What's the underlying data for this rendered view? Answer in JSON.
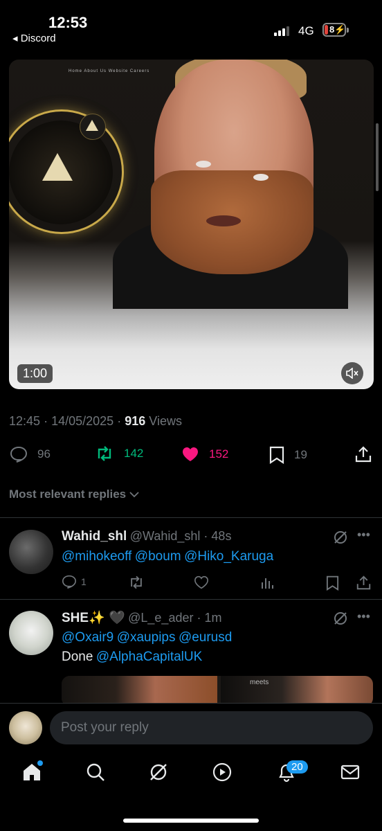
{
  "status_bar": {
    "time": "12:53",
    "back_app": "◂ Discord",
    "network": "4G",
    "battery": "8"
  },
  "video": {
    "site_nav": "Home   About Us   Website   Careers",
    "duration": "1:00",
    "mute_icon": "speaker-muted-icon"
  },
  "post_meta": {
    "time": "12:45",
    "date": "14/05/2025",
    "views_count": "916",
    "views_label": "Views",
    "sep": "·"
  },
  "stats": {
    "replies": "96",
    "reposts": "142",
    "likes": "152",
    "bookmarks": "19"
  },
  "replies_header": "Most relevant replies",
  "replies": [
    {
      "name": "Wahid_shl",
      "handle": "@Wahid_shl",
      "time": "48s",
      "mentions": [
        "@mihokeoff",
        "@boum",
        "@Hiko_Karuga"
      ],
      "reply_count": "1"
    },
    {
      "name": "SHE✨ 🖤",
      "handle": "@L_e_ader",
      "time": "1m",
      "mentions": [
        "@Oxair9",
        "@xaupips",
        "@eurusd"
      ],
      "done_text": "Done",
      "done_mention": "@AlphaCapitalUK",
      "thumb_text": "meets"
    }
  ],
  "reply_bar": {
    "placeholder": "Post your reply"
  },
  "bottom_nav": {
    "notifications_badge": "20"
  },
  "colors": {
    "accent": "#1d9bf0",
    "repost": "#00ba7c",
    "like": "#f91880",
    "muted": "#71767b"
  }
}
